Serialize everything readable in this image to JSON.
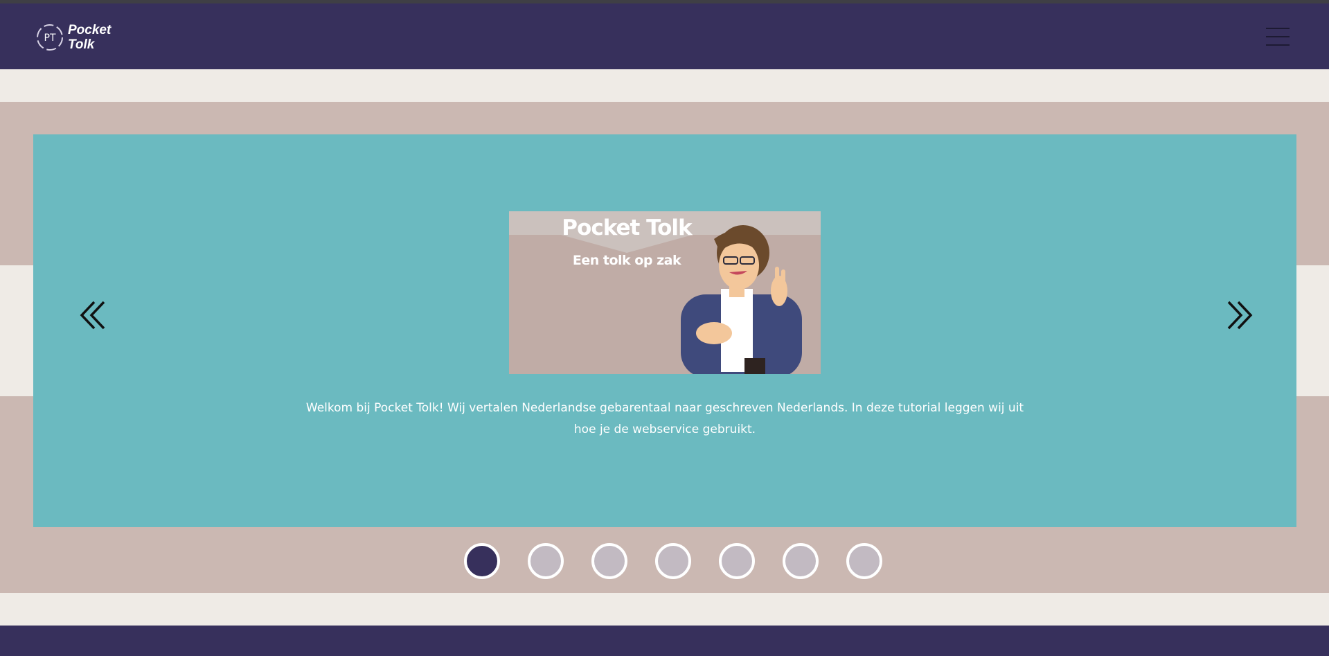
{
  "header": {
    "logo_monogram": "PT",
    "logo_line1": "Pocket",
    "logo_line2": "Tolk",
    "menu_icon": "hamburger-menu-icon"
  },
  "carousel": {
    "prev_icon": "double-chevron-left-icon",
    "next_icon": "double-chevron-right-icon",
    "slide": {
      "image_title": "Pocket Tolk",
      "image_subtitle": "Een tolk op zak",
      "text": "Welkom bij Pocket Tolk! Wij vertalen Nederlandse gebarentaal naar geschreven Nederlands. In deze tutorial leggen wij uit hoe je de webservice gebruikt."
    },
    "total_slides": 7,
    "active_slide": 1
  },
  "colors": {
    "header": "#37305c",
    "slide_background": "#6bbac0",
    "band": "#cbb8b2",
    "page_background": "#efebe6",
    "dot_active": "#37305c",
    "dot_inactive": "#c2bac2"
  }
}
